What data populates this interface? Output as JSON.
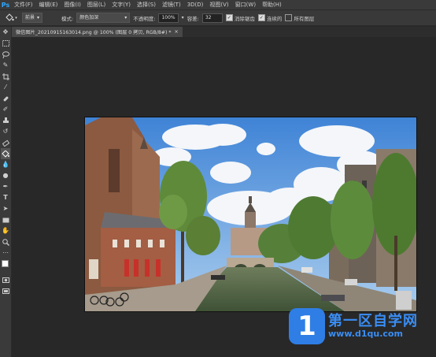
{
  "app": {
    "logo": "Ps"
  },
  "menu": [
    "文件(F)",
    "编辑(E)",
    "图像(I)",
    "图层(L)",
    "文字(Y)",
    "选择(S)",
    "滤镜(T)",
    "3D(D)",
    "视图(V)",
    "窗口(W)",
    "帮助(H)"
  ],
  "options": {
    "preset": "前景",
    "mode_label": "模式:",
    "mode_value": "颜色加深",
    "opacity_label": "不透明度:",
    "opacity_value": "100%",
    "tolerance_label": "容差:",
    "tolerance_value": "32",
    "antialias_label": "消除锯齿",
    "contiguous_label": "连续的",
    "all_layers_label": "所有图层"
  },
  "document_tab": {
    "title": "微信图片_20210915163014.png @ 100% (图层 0 拷贝, RGB/8#) *",
    "close": "×"
  },
  "colors": {
    "foreground": "#ffffff",
    "background": "#000000",
    "accent": "#31a8ff"
  },
  "watermark": {
    "title": "第一区自学网",
    "url": "www.d1qu.com",
    "icon_char": "1"
  }
}
